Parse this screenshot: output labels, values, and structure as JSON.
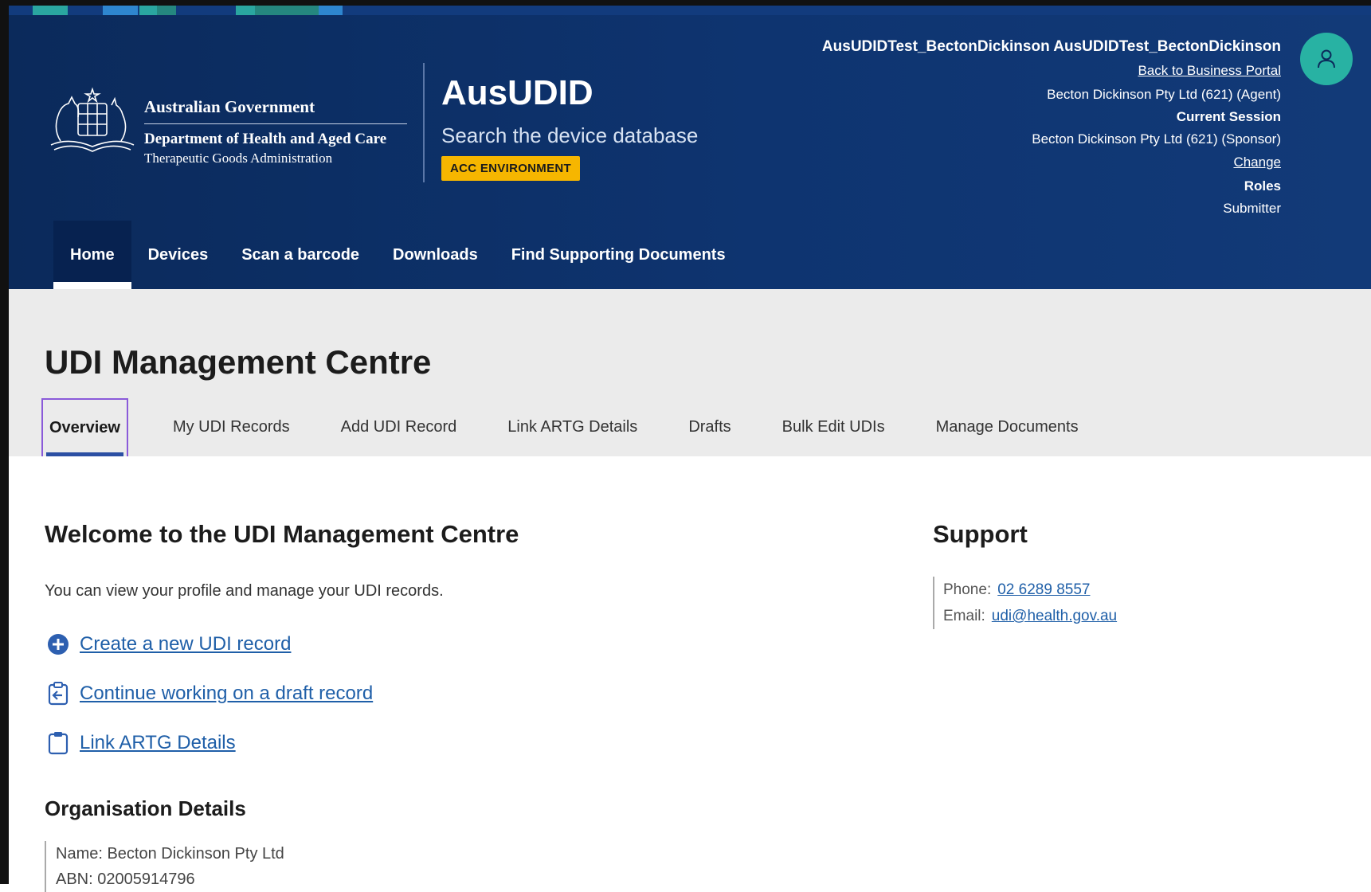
{
  "header": {
    "gov": {
      "title": "Australian Government",
      "department": "Department of Health and Aged Care",
      "agency": "Therapeutic Goods Administration"
    },
    "app_name": "AusUDID",
    "app_subtitle": "Search the device database",
    "environment_badge": "ACC ENVIRONMENT",
    "user": {
      "name": "AusUDIDTest_BectonDickinson AusUDIDTest_BectonDickinson",
      "back_link": "Back to Business Portal",
      "org": "Becton Dickinson Pty Ltd (621) (Agent)",
      "session_label": "Current Session",
      "session_value": "Becton Dickinson Pty Ltd (621) (Sponsor)",
      "change_link": "Change",
      "roles_label": "Roles",
      "roles_value": "Submitter"
    },
    "avatar_icon": "user-icon"
  },
  "nav": {
    "items": [
      {
        "label": "Home",
        "active": true
      },
      {
        "label": "Devices"
      },
      {
        "label": "Scan a barcode"
      },
      {
        "label": "Downloads"
      },
      {
        "label": "Find Supporting Documents"
      }
    ]
  },
  "page": {
    "title": "UDI Management Centre",
    "tabs": [
      {
        "label": "Overview",
        "active": true
      },
      {
        "label": "My UDI Records"
      },
      {
        "label": "Add UDI Record"
      },
      {
        "label": "Link ARTG Details"
      },
      {
        "label": "Drafts"
      },
      {
        "label": "Bulk Edit UDIs"
      },
      {
        "label": "Manage Documents"
      }
    ]
  },
  "main": {
    "welcome_title": "Welcome to the UDI Management Centre",
    "intro": "You can view your profile and manage your UDI records.",
    "actions": [
      {
        "label": "Create a new UDI record",
        "icon": "plus-circle-icon"
      },
      {
        "label": "Continue working on a draft record",
        "icon": "clipboard-return-icon"
      },
      {
        "label": "Link ARTG Details",
        "icon": "clipboard-icon"
      }
    ],
    "org_title": "Organisation Details",
    "org": {
      "name_label": "Name:",
      "name_value": "Becton Dickinson Pty Ltd",
      "abn_partial": "ABN: 02005914796"
    }
  },
  "support": {
    "title": "Support",
    "phone_label": "Phone:",
    "phone_value": "02 6289 8557",
    "email_label": "Email:",
    "email_value": "udi@health.gov.au"
  },
  "colors": {
    "header_bg": "#0e3470",
    "accent_teal": "#28b2a3",
    "badge_yellow": "#f6b600",
    "link_blue": "#1f5fa8",
    "tab_focus": "#8a5ad9"
  }
}
